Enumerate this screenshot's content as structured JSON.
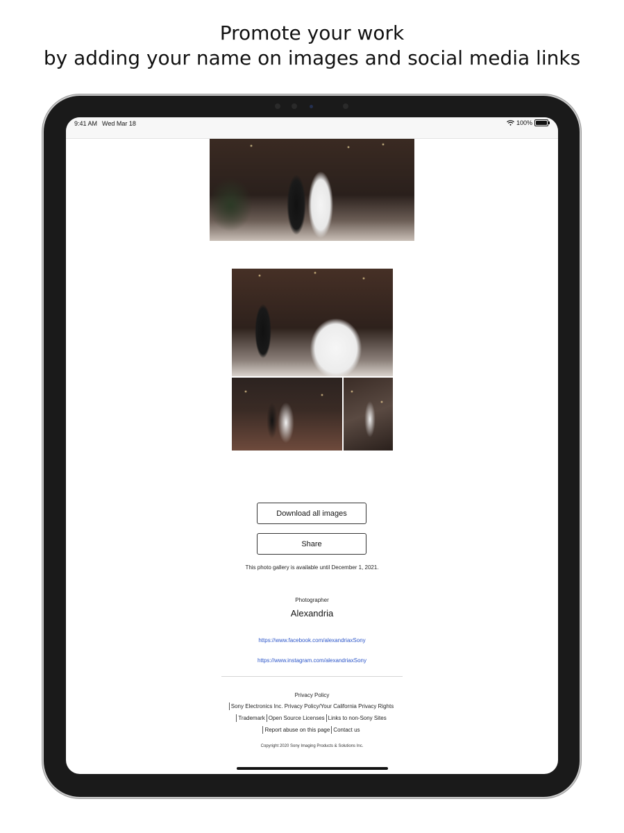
{
  "headline": {
    "line1": "Promote your work",
    "line2": "by adding your name on images and social media links"
  },
  "status_bar": {
    "time": "9:41 AM",
    "date": "Wed Mar 18",
    "battery": "100%"
  },
  "gallery": {
    "images": [
      {
        "name": "wedding-photo-1"
      },
      {
        "name": "wedding-photo-2"
      },
      {
        "name": "wedding-photo-3"
      },
      {
        "name": "wedding-photo-4"
      }
    ],
    "download_label": "Download all images",
    "share_label": "Share",
    "availability_text": "This photo gallery is available until December 1, 2021."
  },
  "photographer": {
    "label": "Photographer",
    "name": "Alexandria",
    "facebook_url": "https://www.facebook.com/alexandriaxSony",
    "instagram_url": "https://www.instagram.com/alexandriaxSony"
  },
  "footer": {
    "privacy_policy": "Privacy Policy",
    "sony_privacy": "Sony Electronics Inc. Privacy Policy/Your California Privacy Rights",
    "trademark": "Trademark",
    "open_source": "Open Source Licenses",
    "non_sony": "Links to non-Sony Sites",
    "report_abuse": "Report abuse on this page",
    "contact": "Contact us",
    "copyright": "Copyright 2020 Sony Imaging Products & Solutions Inc."
  },
  "colors": {
    "link": "#2b55c9",
    "device_bezel": "#1a1a1a"
  }
}
